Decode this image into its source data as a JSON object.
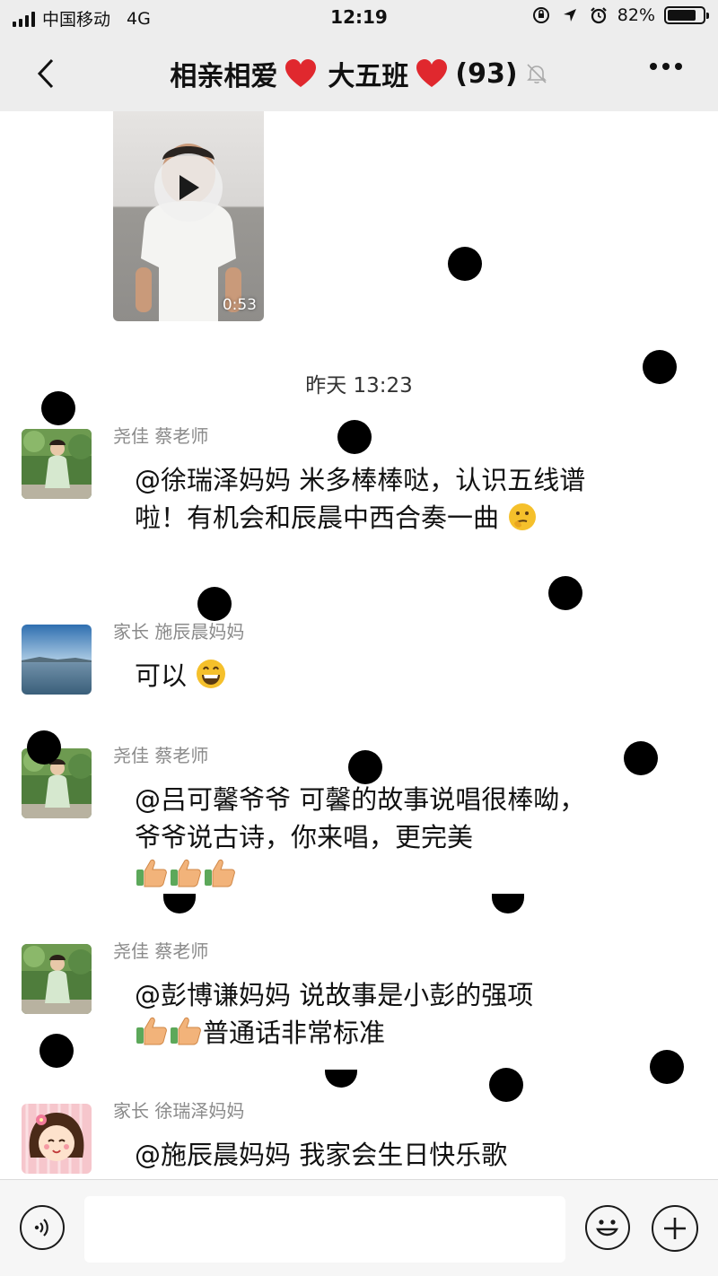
{
  "status_bar": {
    "carrier": "中国移动",
    "network": "4G",
    "time": "12:19",
    "battery_text": "82%",
    "battery_level": 0.82
  },
  "nav": {
    "title_part1": "相亲相爱",
    "title_part2": "大五班",
    "member_count": "(93)",
    "back_icon": "chevron-left-icon",
    "mute_icon": "bell-off-icon",
    "more_icon": "more-dots-icon",
    "heart_color": "#e0282e"
  },
  "video": {
    "duration": "0:53"
  },
  "timestamp": "昨天 13:23",
  "messages": [
    {
      "sender": "尧佳 蔡老师",
      "text": "@徐瑞泽妈妈 米多棒棒哒，认识五线谱啦！有机会和辰晨中西合奏一曲",
      "emoji": [
        "thinking-face-emoji"
      ]
    },
    {
      "sender": "家长 施辰晨妈妈",
      "text": "可以",
      "emoji": [
        "grinning-face-emoji"
      ]
    },
    {
      "sender": "尧佳 蔡老师",
      "text": "@吕可馨爷爷 可馨的故事说唱很棒呦，爷爷说古诗，你来唱，更完美",
      "emoji": [
        "thumbs-up-emoji",
        "thumbs-up-emoji",
        "thumbs-up-emoji"
      ]
    },
    {
      "sender": "尧佳 蔡老师",
      "text_before": "@彭博谦妈妈 说故事是小彭的强项",
      "text_after": "普通话非常标准",
      "emoji": [
        "thumbs-up-emoji",
        "thumbs-up-emoji"
      ]
    },
    {
      "sender": "家长 徐瑞泽妈妈",
      "text": "@施辰晨妈妈 我家会生日快乐歌"
    }
  ],
  "input_bar": {
    "placeholder": "",
    "voice_icon": "voice-icon",
    "emoji_icon": "smiley-icon",
    "plus_icon": "plus-icon"
  }
}
